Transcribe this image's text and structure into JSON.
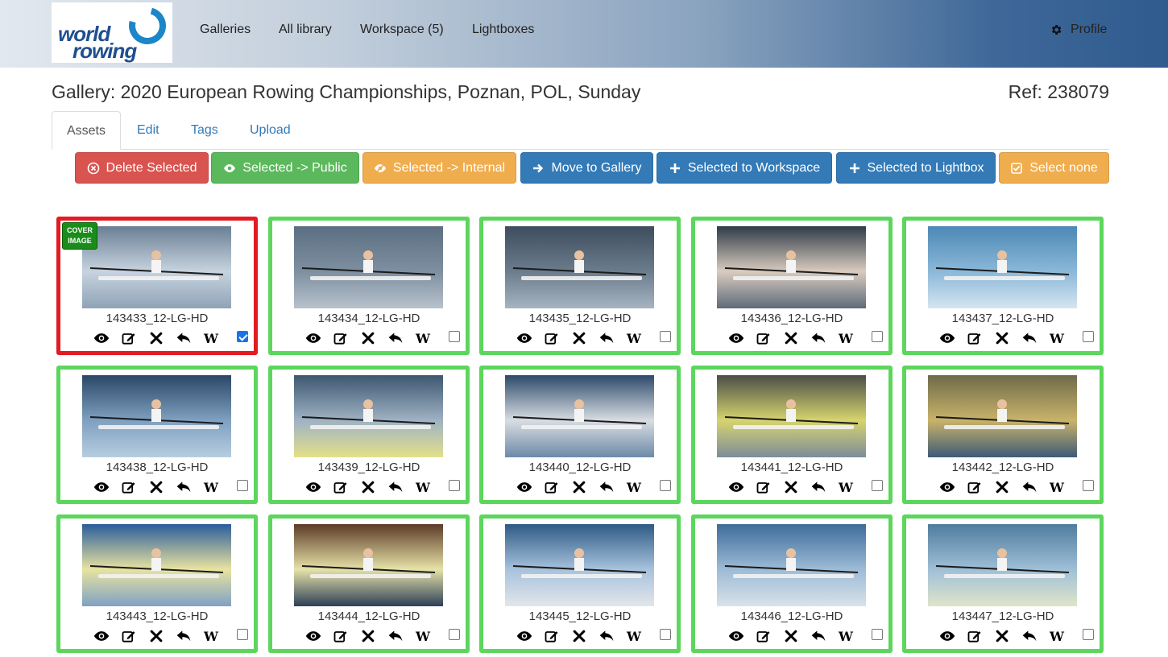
{
  "brand": {
    "line1": "world",
    "line2": "rowing"
  },
  "nav": {
    "galleries": "Galleries",
    "all_library": "All library",
    "workspace": "Workspace (5)",
    "lightboxes": "Lightboxes",
    "profile": "Profile"
  },
  "page": {
    "title": "Gallery: 2020 European Rowing Championships, Poznan, POL, Sunday",
    "ref": "Ref: 238079"
  },
  "tabs": [
    "Assets",
    "Edit",
    "Tags",
    "Upload"
  ],
  "actions": {
    "delete": "Delete Selected",
    "public": "Selected -> Public",
    "internal": "Selected -> Internal",
    "move": "Move to Gallery",
    "workspace": "Selected to Workspace",
    "lightbox": "Selected to Lightbox",
    "none": "Select none"
  },
  "colors": {
    "cover_border": "#e31b23",
    "card_border": "#5cd65c",
    "link": "#337ab7"
  },
  "cover_badge": "COVER IMAGE",
  "w_label": "W",
  "assets": [
    {
      "name": "143433_12-LG-HD",
      "cover": true,
      "checked": true
    },
    {
      "name": "143434_12-LG-HD",
      "cover": false,
      "checked": false
    },
    {
      "name": "143435_12-LG-HD",
      "cover": false,
      "checked": false
    },
    {
      "name": "143436_12-LG-HD",
      "cover": false,
      "checked": false
    },
    {
      "name": "143437_12-LG-HD",
      "cover": false,
      "checked": false
    },
    {
      "name": "143438_12-LG-HD",
      "cover": false,
      "checked": false
    },
    {
      "name": "143439_12-LG-HD",
      "cover": false,
      "checked": false
    },
    {
      "name": "143440_12-LG-HD",
      "cover": false,
      "checked": false
    },
    {
      "name": "143441_12-LG-HD",
      "cover": false,
      "checked": false
    },
    {
      "name": "143442_12-LG-HD",
      "cover": false,
      "checked": false
    },
    {
      "name": "143443_12-LG-HD",
      "cover": false,
      "checked": false
    },
    {
      "name": "143444_12-LG-HD",
      "cover": false,
      "checked": false
    },
    {
      "name": "143445_12-LG-HD",
      "cover": false,
      "checked": false
    },
    {
      "name": "143446_12-LG-HD",
      "cover": false,
      "checked": false
    },
    {
      "name": "143447_12-LG-HD",
      "cover": false,
      "checked": false
    }
  ]
}
